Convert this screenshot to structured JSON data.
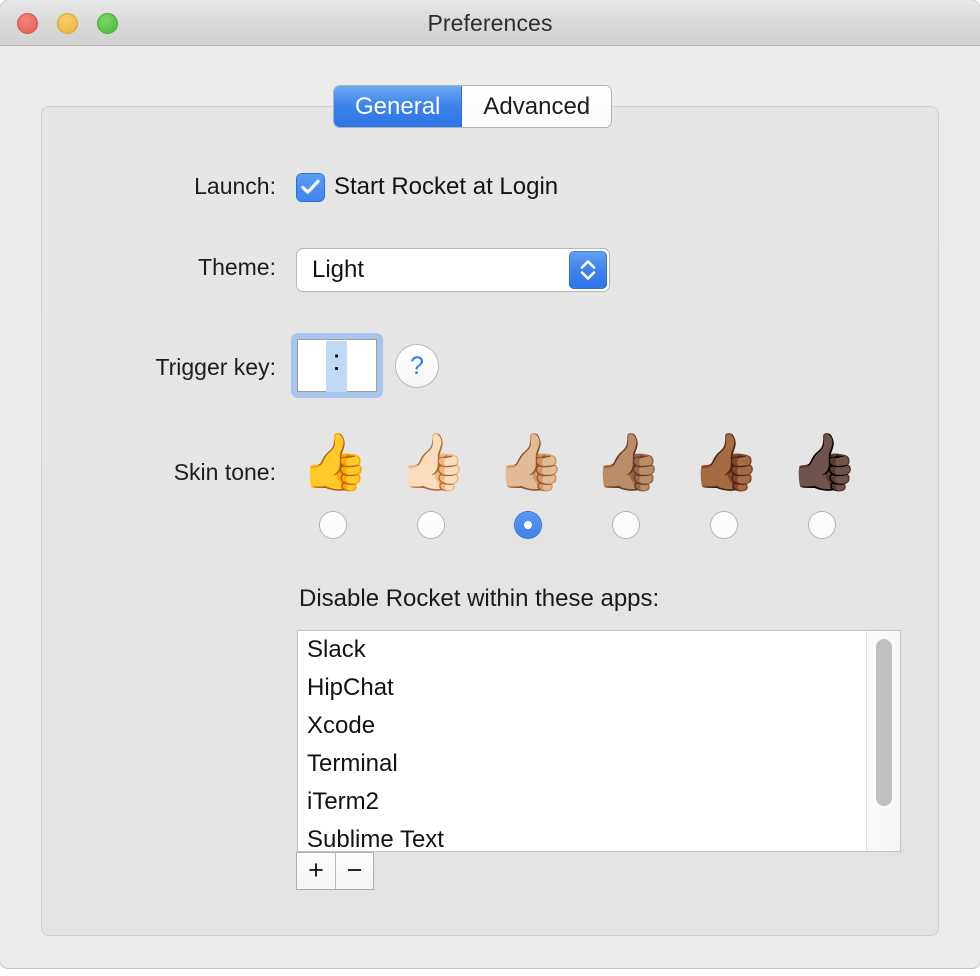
{
  "window": {
    "title": "Preferences",
    "traffic_lights": [
      {
        "name": "close",
        "color": "#ec6a60"
      },
      {
        "name": "minimize",
        "color": "#f0bf4c"
      },
      {
        "name": "zoom",
        "color": "#5dc54c"
      }
    ]
  },
  "tabs": [
    {
      "label": "General",
      "selected": true
    },
    {
      "label": "Advanced",
      "selected": false
    }
  ],
  "form": {
    "launch": {
      "label": "Launch:",
      "checkbox_label": "Start Rocket at Login",
      "checked": true
    },
    "theme": {
      "label": "Theme:",
      "value": "Light"
    },
    "trigger_key": {
      "label": "Trigger key:",
      "value": ":",
      "help_glyph": "?"
    },
    "skin_tone": {
      "label": "Skin tone:",
      "options": [
        {
          "emoji": "👍",
          "name": "thumbs-up-default",
          "selected": false
        },
        {
          "emoji": "👍🏻",
          "name": "thumbs-up-light",
          "selected": false
        },
        {
          "emoji": "👍🏼",
          "name": "thumbs-up-medium-light",
          "selected": true
        },
        {
          "emoji": "👍🏽",
          "name": "thumbs-up-medium",
          "selected": false
        },
        {
          "emoji": "👍🏾",
          "name": "thumbs-up-medium-dark",
          "selected": false
        },
        {
          "emoji": "👍🏿",
          "name": "thumbs-up-dark",
          "selected": false
        }
      ]
    }
  },
  "apps_list": {
    "caption": "Disable Rocket within these apps:",
    "items": [
      {
        "name": "Slack"
      },
      {
        "name": "HipChat"
      },
      {
        "name": "Xcode"
      },
      {
        "name": "Terminal"
      },
      {
        "name": "iTerm2"
      },
      {
        "name": "Sublime Text"
      }
    ],
    "add_label": "+",
    "remove_label": "−"
  },
  "colors": {
    "accent": "#3d81ea",
    "window_bg": "#ececec",
    "panel_bg": "#e4e4e4",
    "titlebar_bg": "#d9d9d9"
  }
}
